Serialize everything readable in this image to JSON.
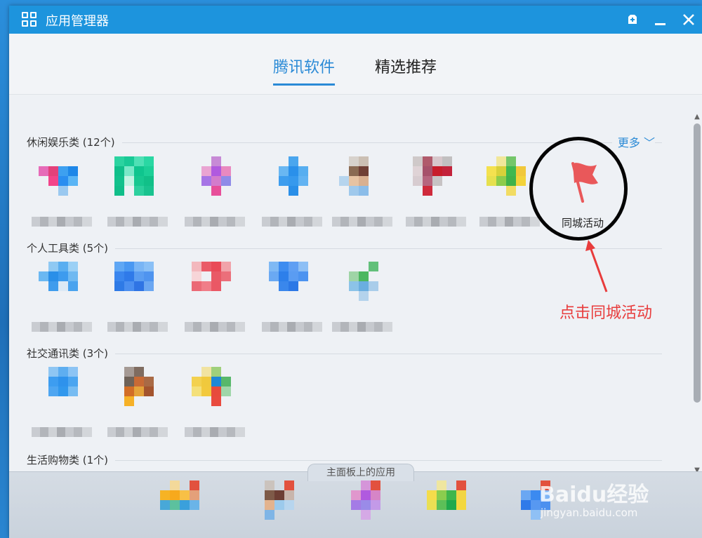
{
  "window": {
    "title": "应用管理器"
  },
  "tabs": [
    {
      "label": "腾讯软件",
      "active": true
    },
    {
      "label": "精选推荐",
      "active": false
    }
  ],
  "sections": [
    {
      "label": "休闲娱乐类 (12个)",
      "more_label": "更多"
    },
    {
      "label": "个人工具类 (5个)"
    },
    {
      "label": "社交通讯类 (3个)"
    },
    {
      "label": "生活购物类 (1个)"
    }
  ],
  "highlighted_app": {
    "label": "同城活动",
    "icon": "red-flag-icon",
    "color": "#e9585a"
  },
  "annotation": {
    "text": "点击同城活动",
    "color": "#e83c3c"
  },
  "bottom_panel": {
    "label": "主面板上的应用"
  },
  "watermark": {
    "logo": "Baidu经验",
    "sub": "jingyan.baidu.com"
  },
  "colors": {
    "accent": "#2a8ad6",
    "titlebar": "#1d94dd"
  }
}
